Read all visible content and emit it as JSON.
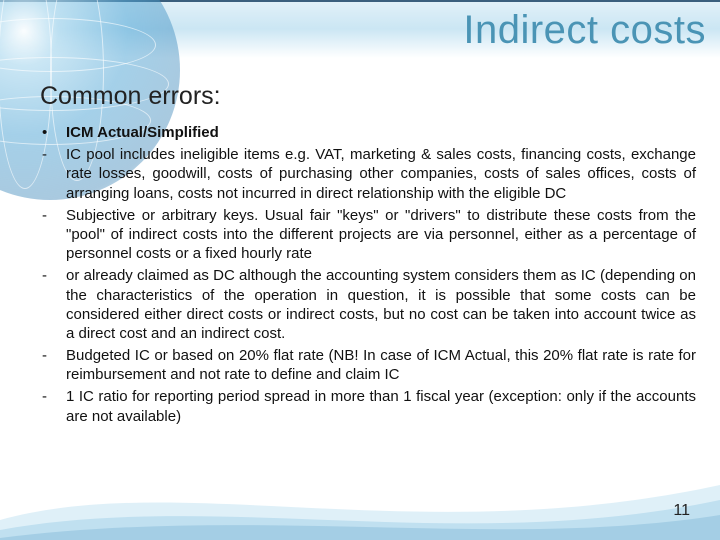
{
  "title": "Indirect costs",
  "subhead": "Common errors:",
  "items": [
    {
      "marker": "•",
      "bold": true,
      "text": "ICM Actual/Simplified"
    },
    {
      "marker": "-",
      "bold": false,
      "text": "IC pool includes ineligible items e.g. VAT, marketing & sales costs, financing costs, exchange rate losses, goodwill, costs of purchasing other companies, costs of sales offices, costs of arranging loans, costs not incurred in direct relationship with the eligible DC"
    },
    {
      "marker": "-",
      "bold": false,
      "text": "Subjective or arbitrary keys. Usual fair \"keys\" or \"drivers\" to distribute these costs from the \"pool\" of indirect costs into the different projects are via personnel, either as a percentage of personnel costs or a fixed hourly rate"
    },
    {
      "marker": "-",
      "bold": false,
      "text": "or already claimed as DC although the accounting system considers them as IC (depending on the characteristics of the operation in question, it is possible that some costs can be considered either direct costs or indirect costs, but no cost can be taken into account twice as a direct cost and an indirect cost."
    },
    {
      "marker": "-",
      "bold": false,
      "text": "Budgeted IC or based on 20% flat rate (NB! In case of ICM Actual, this 20% flat rate is rate for reimbursement and not rate to define and claim IC"
    },
    {
      "marker": "-",
      "bold": false,
      "text": "1 IC ratio for reporting period spread in more than 1 fiscal year (exception: only if the accounts are not available)"
    }
  ],
  "pagenum": "11"
}
